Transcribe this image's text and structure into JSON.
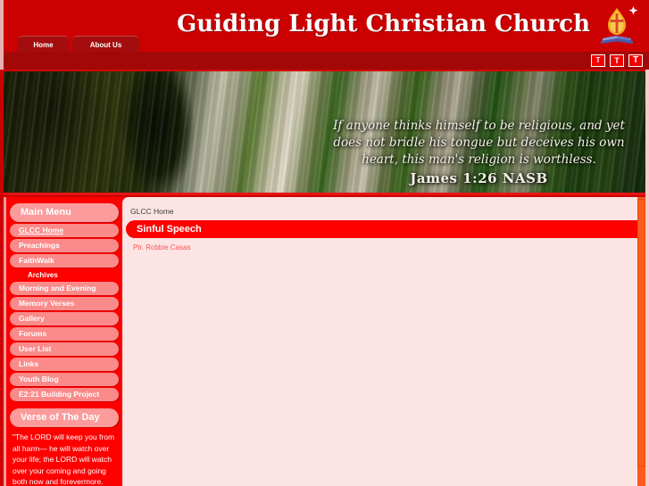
{
  "header": {
    "site_title": "Guiding Light Christian Church",
    "logo_icon": "candle-flame-book-logo",
    "nav_tabs": [
      {
        "label": "Home",
        "active": true
      },
      {
        "label": "About Us",
        "active": false
      }
    ],
    "text_size_buttons": [
      {
        "label": "T",
        "name": "text-size-small"
      },
      {
        "label": "T",
        "name": "text-size-medium"
      },
      {
        "label": "T",
        "name": "text-size-large"
      }
    ]
  },
  "banner": {
    "image_description": "close-up photograph of green plant shoots and buds",
    "verse_text": "If anyone thinks himself to be religious, and yet does not bridle his tongue but deceives his own heart, this man's religion is worthless.",
    "verse_reference": "James 1:26 NASB"
  },
  "sidebar": {
    "main_menu_header": "Main Menu",
    "items": [
      {
        "label": "GLCC Home",
        "active": true
      },
      {
        "label": "Preachings",
        "active": false
      },
      {
        "label": "FaithWalk",
        "active": false
      }
    ],
    "archives_label": "Archives",
    "archive_items": [
      {
        "label": "Morning and Evening"
      },
      {
        "label": "Memory Verses"
      },
      {
        "label": "Gallery"
      },
      {
        "label": "Forums"
      },
      {
        "label": "User List"
      },
      {
        "label": "Links"
      },
      {
        "label": "Youth Blog"
      },
      {
        "label": "E2:21 Building Project"
      }
    ],
    "verse_of_day_header": "Verse of The Day",
    "verse_of_day_text": "\"The LORD will keep you from all harm— he will watch over your life; the LORD will watch over your coming and going both now and forevermore."
  },
  "content": {
    "breadcrumb": "GLCC Home",
    "article_title": "Sinful Speech",
    "article_author": "Ptr. Robbie Casas",
    "article_body": ""
  },
  "colors": {
    "brand_red": "#cc0000",
    "bright_red": "#fe0000",
    "tab_dark_red": "#a30d0d",
    "content_bg": "#fce4e4",
    "sidebar_pill": "#fb8a8a",
    "sidebar_header_pill": "#fb9b9b",
    "scrollbar_orange": "#fd5a22",
    "author_pink": "#ff5555"
  }
}
